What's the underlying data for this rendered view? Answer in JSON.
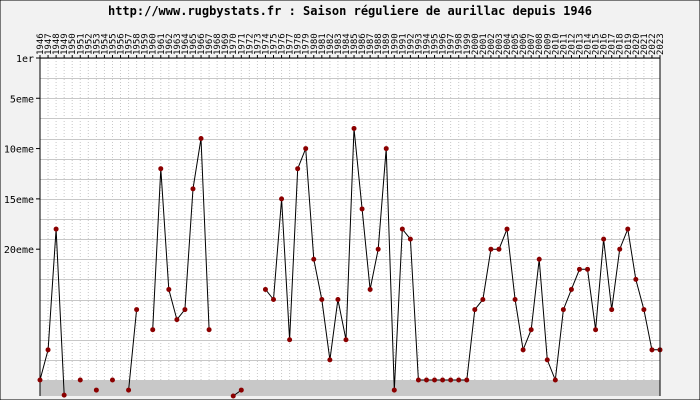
{
  "chart_data": {
    "type": "line",
    "title": "http://www.rugbystats.fr : Saison réguliere de aurillac depuis 1946",
    "xlabel": "",
    "ylabel": "",
    "y_tick_labels": [
      {
        "label": "1er",
        "value": 1
      },
      {
        "label": "5eme",
        "value": 5
      },
      {
        "label": "10eme",
        "value": 10
      },
      {
        "label": "15eme",
        "value": 15
      },
      {
        "label": "20eme",
        "value": 20
      }
    ],
    "y_inverted": true,
    "ylim": [
      1,
      33
    ],
    "grid": true,
    "x": [
      1946,
      1947,
      1948,
      1949,
      1950,
      1951,
      1952,
      1953,
      1954,
      1955,
      1956,
      1957,
      1958,
      1959,
      1960,
      1961,
      1962,
      1963,
      1964,
      1965,
      1966,
      1967,
      1968,
      1969,
      1970,
      1971,
      1972,
      1973,
      1974,
      1975,
      1976,
      1977,
      1978,
      1979,
      1980,
      1981,
      1982,
      1983,
      1984,
      1985,
      1986,
      1987,
      1988,
      1989,
      1990,
      1991,
      1992,
      1993,
      1994,
      1995,
      1996,
      1997,
      1998,
      1999,
      2000,
      2001,
      2002,
      2003,
      2004,
      2005,
      2006,
      2007,
      2008,
      2009,
      2010,
      2011,
      2012,
      2013,
      2014,
      2015,
      2016,
      2017,
      2018,
      2019,
      2020,
      2021,
      2022,
      2023
    ],
    "series": [
      {
        "values": [
          33,
          30,
          18,
          34.5,
          null,
          33,
          null,
          34,
          null,
          33,
          null,
          34,
          26,
          null,
          28,
          12,
          24,
          27,
          26,
          14,
          9,
          28,
          null,
          null,
          35,
          34,
          null,
          null,
          24,
          25,
          15,
          29,
          12,
          10,
          21,
          25,
          31,
          25,
          29,
          8,
          16,
          24,
          20,
          10,
          34,
          18,
          19,
          33,
          33,
          33,
          33,
          33,
          33,
          33,
          26,
          25,
          20,
          20,
          18,
          25,
          30,
          28,
          21,
          31,
          33,
          26,
          24,
          22,
          22,
          28,
          19,
          26,
          20,
          18,
          23,
          26,
          30,
          30,
          26,
          25,
          25
        ],
        "color": "#000000",
        "marker_color": "#8b0000"
      }
    ],
    "colors": {
      "frame_bg": "#f2f2f2",
      "plot_bg": "#ffffff",
      "bottom_band": "#c8c8c8",
      "grid": "#c8c8c8",
      "line": "#000000",
      "marker": "#8b0000"
    }
  }
}
